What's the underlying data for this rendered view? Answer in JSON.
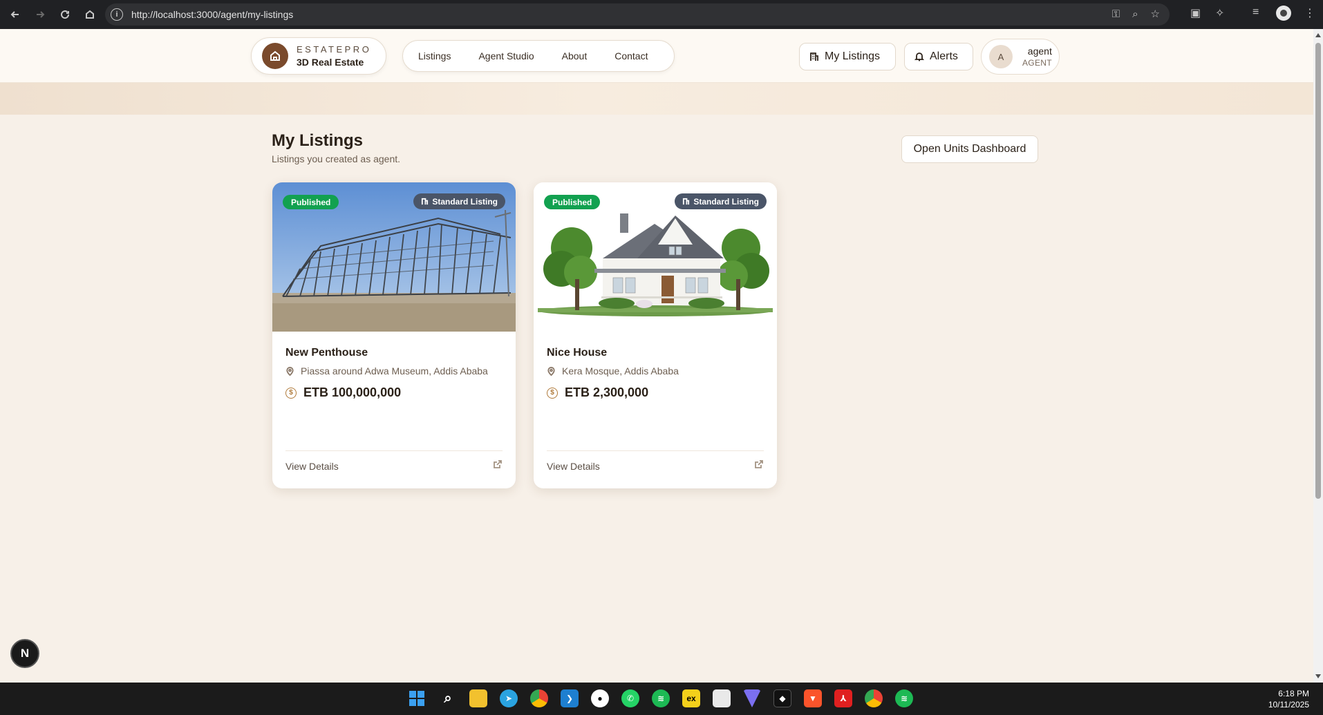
{
  "browser": {
    "url": "http://localhost:3000/agent/my-listings",
    "info_icon": "info-icon",
    "icons": [
      "back-icon",
      "forward-icon",
      "reload-icon",
      "home-icon",
      "key-icon",
      "zoom-icon",
      "star-icon",
      "extension-icon",
      "puzzle-icon",
      "media-icon",
      "profile-icon",
      "menu-icon"
    ]
  },
  "brand": {
    "name": "ESTATEPRO",
    "sub": "3D Real Estate"
  },
  "nav": {
    "items": [
      {
        "label": "Listings"
      },
      {
        "label": "Agent Studio"
      },
      {
        "label": "About"
      },
      {
        "label": "Contact"
      }
    ]
  },
  "header": {
    "my_listings_label": "My Listings",
    "alerts_label": "Alerts",
    "user": {
      "initial": "A",
      "name": "agent",
      "role": "AGENT"
    }
  },
  "main": {
    "title": "My Listings",
    "subtitle": "Listings you created as agent.",
    "units_button": "Open Units Dashboard"
  },
  "listings": [
    {
      "status": "Published",
      "type": "Standard Listing",
      "title": "New Penthouse",
      "location": "Piassa around Adwa Museum, Addis Ababa",
      "price": "ETB 100,000,000",
      "view_label": "View Details",
      "image": "steel-frame-construction-photo"
    },
    {
      "status": "Published",
      "type": "Standard Listing",
      "title": "Nice House",
      "location": "Kera Mosque, Addis Ababa",
      "price": "ETB 2,300,000",
      "view_label": "View Details",
      "image": "white-house-photo"
    }
  ],
  "dev_indicator": "N",
  "taskbar": {
    "time": "6:18 PM",
    "date": "10/11/2025",
    "apps": [
      "windows-start-icon",
      "search-icon",
      "file-explorer-icon",
      "telegram-icon",
      "chrome-icon",
      "vscode-icon",
      "github-icon",
      "whatsapp-icon",
      "spotify-icon",
      "ex-app-icon",
      "snipping-icon",
      "vpn-icon",
      "notion-icon",
      "brave-icon",
      "acrobat-icon",
      "chrome-profile-icon",
      "spotify-2-icon"
    ]
  },
  "colors": {
    "brand": "#7a4a2c",
    "published": "#12a150",
    "standard_badge": "#4a5568",
    "page_bg": "#f7f0e8"
  }
}
